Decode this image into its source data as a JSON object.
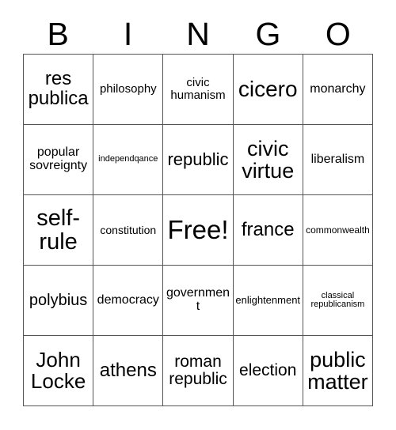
{
  "card": {
    "header_letters": [
      "B",
      "I",
      "N",
      "G",
      "O"
    ],
    "free_space_label": "Free!",
    "rows": [
      [
        {
          "text": "res publica",
          "size": 24
        },
        {
          "text": "philosophy",
          "size": 15
        },
        {
          "text": "civic humanism",
          "size": 15
        },
        {
          "text": "cicero",
          "size": 28
        },
        {
          "text": "monarchy",
          "size": 16
        }
      ],
      [
        {
          "text": "popular sovreignty",
          "size": 16
        },
        {
          "text": "independqance",
          "size": 11
        },
        {
          "text": "republic",
          "size": 22
        },
        {
          "text": "civic virtue",
          "size": 27
        },
        {
          "text": "liberalism",
          "size": 16
        }
      ],
      [
        {
          "text": "self-rule",
          "size": 29
        },
        {
          "text": "constitution",
          "size": 14
        },
        {
          "text": "Free!",
          "size": 33
        },
        {
          "text": "france",
          "size": 24
        },
        {
          "text": "commonwealth",
          "size": 12
        }
      ],
      [
        {
          "text": "polybius",
          "size": 20
        },
        {
          "text": "democracy",
          "size": 16
        },
        {
          "text": "government",
          "size": 16
        },
        {
          "text": "enlightenment",
          "size": 13
        },
        {
          "text": "classical republicanism",
          "size": 11
        }
      ],
      [
        {
          "text": "John Locke",
          "size": 26
        },
        {
          "text": "athens",
          "size": 24
        },
        {
          "text": "roman republic",
          "size": 21
        },
        {
          "text": "election",
          "size": 21
        },
        {
          "text": "public matter",
          "size": 27
        }
      ]
    ]
  }
}
